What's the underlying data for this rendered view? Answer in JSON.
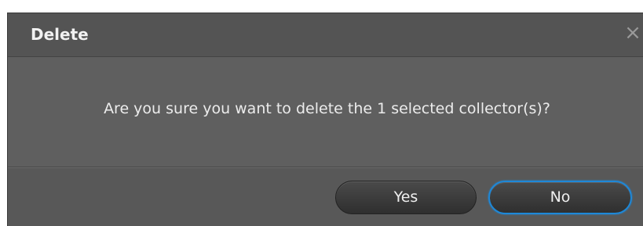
{
  "dialog": {
    "title": "Delete",
    "close_glyph": "×",
    "message": "Are you sure you want to delete the 1 selected collector(s)?",
    "buttons": {
      "yes_label": "Yes",
      "no_label": "No"
    }
  },
  "icons": {
    "close": "close-icon"
  },
  "colors": {
    "dialog_bg": "#5c5c5c",
    "focus_ring": "#1e88d8",
    "text": "#ececec"
  }
}
